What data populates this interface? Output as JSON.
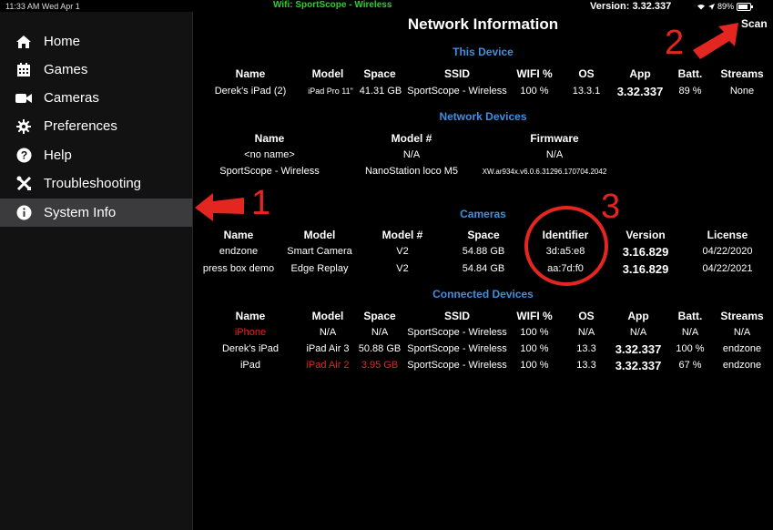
{
  "status_bar": {
    "time_date": "11:33 AM  Wed Apr 1",
    "wifi": "Wifi: SportScope - Wireless",
    "version": "Version: 3.32.337",
    "battery": "89%"
  },
  "sidebar": {
    "items": [
      {
        "label": "Home",
        "icon": "home-icon"
      },
      {
        "label": "Games",
        "icon": "calendar-icon"
      },
      {
        "label": "Cameras",
        "icon": "video-camera-icon"
      },
      {
        "label": "Preferences",
        "icon": "gear-icon"
      },
      {
        "label": "Help",
        "icon": "question-circle-icon"
      },
      {
        "label": "Troubleshooting",
        "icon": "tools-icon"
      },
      {
        "label": "System Info",
        "icon": "info-circle-icon",
        "active": true
      }
    ]
  },
  "header": {
    "title": "Network Information",
    "scan_label": "Scan"
  },
  "this_device": {
    "title": "This Device",
    "headers": [
      "Name",
      "Model",
      "Space",
      "SSID",
      "WIFI %",
      "OS",
      "App",
      "Batt.",
      "Streams"
    ],
    "row": [
      "Derek's iPad (2)",
      "iPad Pro 11\"",
      "41.31 GB",
      "SportScope - Wireless",
      "100 %",
      "13.3.1",
      "3.32.337",
      "89 %",
      "None"
    ]
  },
  "network_devices": {
    "title": "Network Devices",
    "headers": [
      "Name",
      "Model #",
      "Firmware"
    ],
    "rows": [
      [
        "<no name>",
        "N/A",
        "N/A"
      ],
      [
        "SportScope - Wireless",
        "NanoStation loco M5",
        "XW.ar934x.v6.0.6.31296.170704.2042"
      ]
    ]
  },
  "cameras": {
    "title": "Cameras",
    "headers": [
      "Name",
      "Model",
      "Model #",
      "Space",
      "Identifier",
      "Version",
      "License"
    ],
    "rows": [
      [
        "endzone",
        "Smart Camera",
        "V2",
        "54.88 GB",
        "3d:a5:e8",
        "3.16.829",
        "04/22/2020"
      ],
      [
        "press box demo",
        "Edge Replay",
        "V2",
        "54.84 GB",
        "aa:7d:f0",
        "3.16.829",
        "04/22/2021"
      ]
    ]
  },
  "connected_devices": {
    "title": "Connected Devices",
    "headers": [
      "Name",
      "Model",
      "Space",
      "SSID",
      "WIFI %",
      "OS",
      "App",
      "Batt.",
      "Streams"
    ],
    "rows": [
      [
        "iPhone",
        "N/A",
        "N/A",
        "SportScope - Wireless",
        "100 %",
        "N/A",
        "N/A",
        "N/A",
        "N/A"
      ],
      [
        "Derek's iPad",
        "iPad Air 3",
        "50.88 GB",
        "SportScope - Wireless",
        "100 %",
        "13.3",
        "3.32.337",
        "100 %",
        "endzone"
      ],
      [
        "iPad",
        "iPad Air 2",
        "3.95 GB",
        "SportScope - Wireless",
        "100 %",
        "13.3",
        "3.32.337",
        "67 %",
        "endzone"
      ]
    ]
  },
  "annotations": {
    "one": "1",
    "two": "2",
    "three": "3",
    "color": "#e3261f"
  },
  "colors": {
    "section_title": "#3f8fe0",
    "wifi_text": "#28d128",
    "warning": "#e3261f"
  }
}
